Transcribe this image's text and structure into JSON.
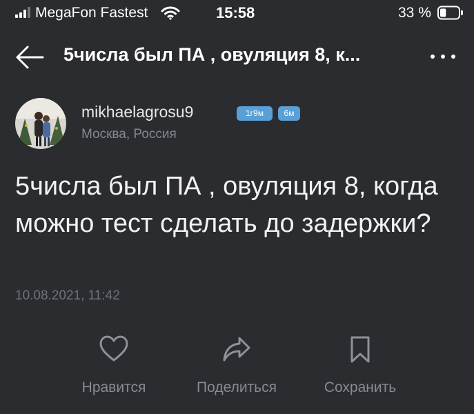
{
  "status_bar": {
    "carrier": "MegaFon Fastest",
    "time": "15:58",
    "battery_percent": "33 %",
    "battery_level": 0.33,
    "icons": [
      "signal-icon",
      "wifi-icon",
      "battery-icon"
    ]
  },
  "header": {
    "title": "5числа был ПА , овуляция 8, к...",
    "back_icon": "arrow-left-icon",
    "more_icon": "more-dots-icon"
  },
  "author": {
    "username": "mikhaelagrosu9",
    "badges": [
      "1г9м",
      "6м"
    ],
    "location": "Москва, Россия"
  },
  "post": {
    "text": "5числа был ПА , овуляция 8, когда можно тест сделать до задержки?",
    "date": "10.08.2021, 11:42"
  },
  "actions": [
    {
      "label": "Нравится",
      "icon": "heart-icon"
    },
    {
      "label": "Поделиться",
      "icon": "share-icon"
    },
    {
      "label": "Сохранить",
      "icon": "bookmark-icon"
    }
  ],
  "colors": {
    "background": "#2b2c30",
    "badge": "#5a9fd6",
    "muted_text": "#878a90",
    "icon_stroke": "#8e9197"
  }
}
